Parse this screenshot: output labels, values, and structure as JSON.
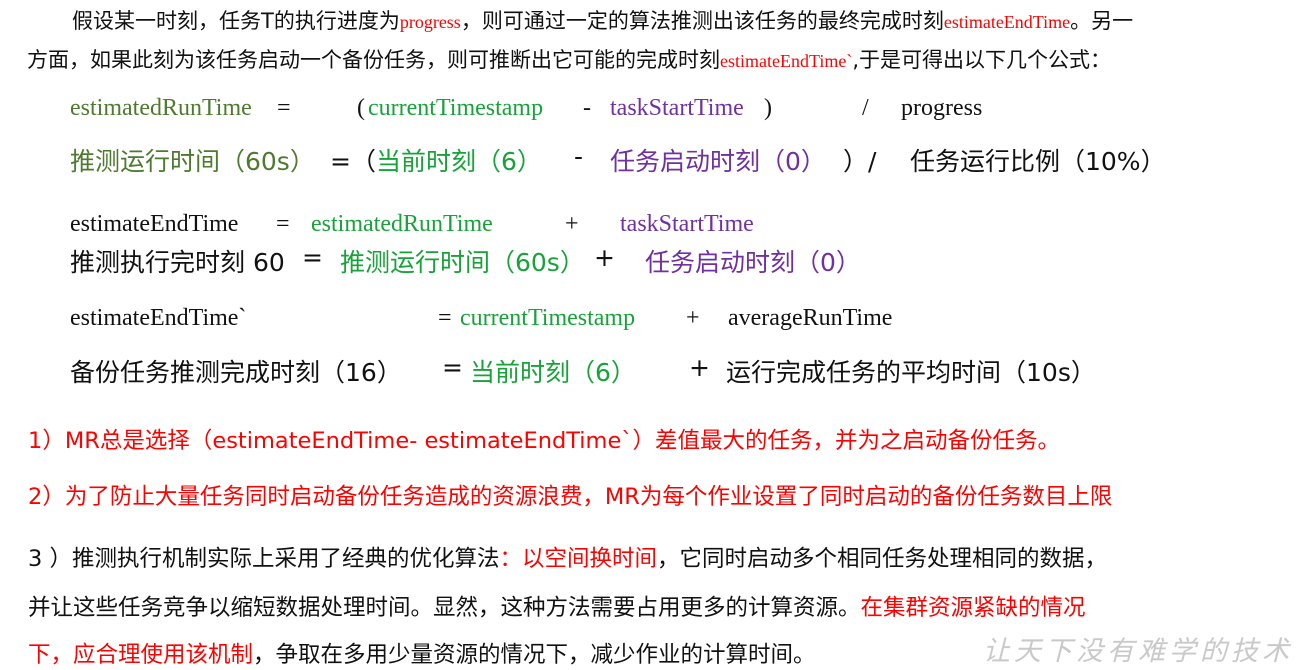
{
  "intro": {
    "l1_a": "假设某一时刻，任务T的执行进度为",
    "l1_b": "progress",
    "l1_c": "，则可通过一定的算法推测出该任务的最终完成时刻",
    "l1_d": "estimateEndTime",
    "l1_e": "。另一",
    "l2_a": "方面，如果此刻为该任务启动一个备份任务，则可推断出它可能的完成时刻",
    "l2_b": "estimateEndTime`",
    "l2_c": ",于是可得出以下几个公式："
  },
  "formula1": {
    "a": "estimatedRunTime",
    "eq": "=",
    "open": "(",
    "b": "currentTimestamp",
    "minus": "-",
    "c": "taskStartTime",
    "close": ")",
    "slash": "/",
    "d": "progress",
    "zh_a": "推测运行时间（60s）",
    "zh_eq": "=（",
    "zh_b": "当前时刻（6）",
    "zh_minus": "-",
    "zh_c": "任务启动时刻（0）",
    "zh_close": "）/",
    "zh_d": "任务运行比例（10%）"
  },
  "formula2": {
    "a": "estimateEndTime",
    "eq": "=",
    "b": "estimatedRunTime",
    "plus": "+",
    "c": "taskStartTime",
    "zh_a": "推测执行完时刻 60",
    "zh_eq": "=",
    "zh_b": "推测运行时间（60s）",
    "zh_plus": "+",
    "zh_c": "任务启动时刻（0）"
  },
  "formula3": {
    "a": "estimateEndTime`",
    "eq": "=",
    "b": "currentTimestamp",
    "plus": "+",
    "c": "averageRunTime",
    "zh_a": "备份任务推测完成时刻（16）",
    "zh_eq": "=",
    "zh_b": "当前时刻（6）",
    "zh_plus": "+",
    "zh_c": "运行完成任务的平均时间（10s）"
  },
  "points": {
    "p1": "1）MR总是选择（estimateEndTime- estimateEndTime`）差值最大的任务，并为之启动备份任务。",
    "p2": "2）为了防止大量任务同时启动备份任务造成的资源浪费，MR为每个作业设置了同时启动的备份任务数目上限",
    "p3_a": "3 ）推测执行机制实际上采用了经典的优化算法",
    "p3_b": "：以空间换时间",
    "p3_c": "，它同时启动多个相同任务处理相同的数据，",
    "p3_d": "并让这些任务竞争以缩短数据处理时间。显然，这种方法需要占用更多的计算资源。",
    "p3_e": "在集群资源紧缺的情况",
    "p3_f": "下，应合理使用该机制",
    "p3_g": "，争取在多用少量资源的情况下，减少作业的计算时间。"
  },
  "watermark": "让天下没有难学的技术"
}
